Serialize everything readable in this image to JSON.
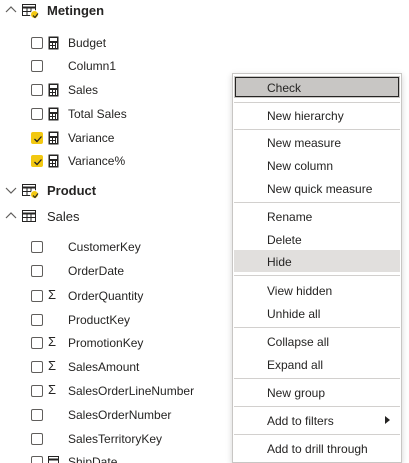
{
  "groups": {
    "metingen": "Metingen",
    "product": "Product",
    "sales": "Sales"
  },
  "metingen_fields": [
    "Budget",
    "Column1",
    "Sales",
    "Total Sales",
    "Variance",
    "Variance%"
  ],
  "sales_fields": [
    "CustomerKey",
    "OrderDate",
    "OrderQuantity",
    "ProductKey",
    "PromotionKey",
    "SalesAmount",
    "SalesOrderLineNumber",
    "SalesOrderNumber",
    "SalesTerritoryKey",
    "ShipDate"
  ],
  "menu": {
    "check": "Check",
    "new_hierarchy": "New hierarchy",
    "new_measure": "New measure",
    "new_column": "New column",
    "new_quick_measure": "New quick measure",
    "rename": "Rename",
    "delete": "Delete",
    "hide": "Hide",
    "view_hidden": "View hidden",
    "unhide_all": "Unhide all",
    "collapse_all": "Collapse all",
    "expand_all": "Expand all",
    "new_group": "New group",
    "add_to_filters": "Add to filters",
    "add_to_drill_through": "Add to drill through"
  },
  "colors": {
    "accent": "#f2c811",
    "hover": "#e1dfdd",
    "selected": "#c8c6c4"
  }
}
